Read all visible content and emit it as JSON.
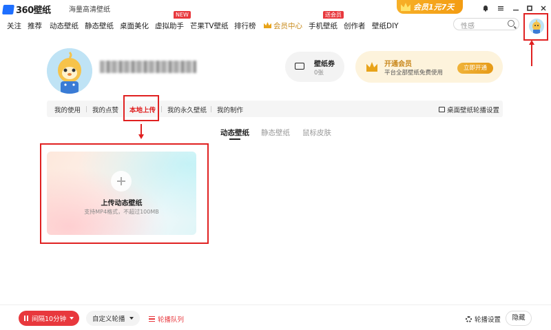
{
  "titlebar": {
    "logo_text": "360壁纸",
    "subtitle": "海量高清壁纸",
    "promo": "会员1元7天"
  },
  "nav": {
    "items": [
      "关注",
      "推荐",
      "动态壁纸",
      "静态壁纸",
      "桌面美化",
      "虚拟助手",
      "芒果TV壁纸",
      "排行榜",
      "会员中心",
      "手机壁纸",
      "创作者",
      "壁纸DIY"
    ],
    "badge_new": "NEW",
    "badge_vip": "送会员",
    "search_placeholder": "性感"
  },
  "profile": {
    "coupon_title": "壁纸券",
    "coupon_count": "0张",
    "vip_title": "开通会员",
    "vip_desc": "平台全部壁纸免费使用",
    "vip_button": "立即开通"
  },
  "tabs": {
    "items": [
      "我的使用",
      "我的点赞",
      "本地上传",
      "我的永久壁纸",
      "我的制作"
    ],
    "active_index": 2,
    "settings_link": "桌面壁纸轮播设置"
  },
  "subtabs": {
    "items": [
      "动态壁纸",
      "静态壁纸",
      "鼠标皮肤"
    ],
    "active_index": 0
  },
  "upload": {
    "title": "上传动态壁纸",
    "hint": "支持MP4格式，不超过100MB"
  },
  "bottom": {
    "interval_label": "间隔10分钟",
    "custom_select": "自定义轮播",
    "queue_label": "轮播队列",
    "settings_label": "轮播设置",
    "hide_label": "隐藏"
  },
  "colors": {
    "accent_red": "#e8383d",
    "annotation_red": "#e02020",
    "vip_gold": "#e8a319"
  }
}
